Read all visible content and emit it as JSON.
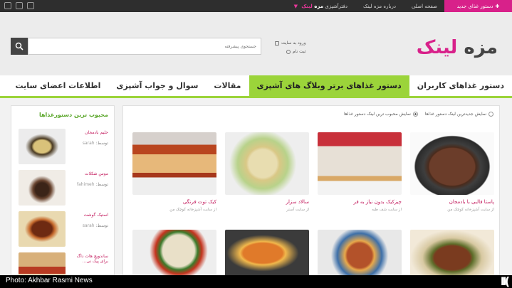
{
  "topbar": {
    "new_button": "دستور غذای جدید",
    "links": [
      "صفحه اصلی",
      "درباره مزه لینک",
      "دفترآشپزی"
    ],
    "brand_prefix": "مزه",
    "brand_suffix": "لینک"
  },
  "header": {
    "logo_part1": "مزه",
    "logo_part2": "لینک",
    "search_placeholder": "جستجوی پیشرفته",
    "login": "ورود به سایت",
    "register": "ثبت نام"
  },
  "nav": [
    {
      "label": "دستور غذاهای کاربران",
      "active": false
    },
    {
      "label": "دستور غذاهای برتر وبلاگ های آشپزی",
      "active": true
    },
    {
      "label": "مقالات",
      "active": false
    },
    {
      "label": "سوال و جواب آشپزی",
      "active": false
    },
    {
      "label": "اطلاعات اعضای سایت",
      "active": false
    }
  ],
  "filters": {
    "option_new": "نمایش جدیدترین لینک دستور غذاها",
    "option_popular": "نمایش محبوب ترین لینک دستور غذاها"
  },
  "recipes": [
    {
      "title": "پاستا فالبی با بادمجان",
      "source": "از سایت آشپزخانه کوچک من"
    },
    {
      "title": "چیزکیک بدون نیاز به فر",
      "source": "از سایت شف طبه"
    },
    {
      "title": "سالاد سزار",
      "source": "از سایت آسنر"
    },
    {
      "title": "کیک توت فرنگی",
      "source": "از سایت آشپزخانه کوچک من"
    },
    {
      "title": "",
      "source": ""
    },
    {
      "title": "",
      "source": ""
    },
    {
      "title": "",
      "source": ""
    },
    {
      "title": "",
      "source": ""
    }
  ],
  "sidebar": {
    "title": "محبوب ترین دستورغذاها",
    "items": [
      {
        "title": "حلیم بادمجان",
        "author_label": "توسط:",
        "author": "sarah"
      },
      {
        "title": "موس شکلات",
        "author_label": "توسط:",
        "author": "fahimeh"
      },
      {
        "title": "استیک گوشت",
        "author_label": "توسط:",
        "author": "sarah"
      },
      {
        "title": "ساندویچ هات داگ برای پیک نی...",
        "author_label": "",
        "author": ""
      }
    ]
  },
  "photo_credit": "Photo: Akhbar Rasmi News",
  "watermark": "ΙΙ("
}
